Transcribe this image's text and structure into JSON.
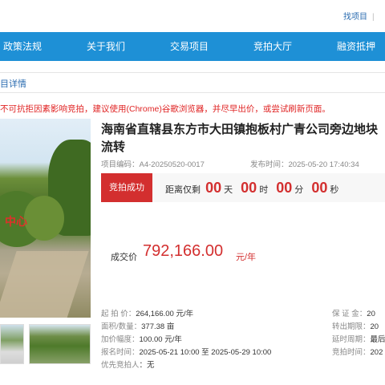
{
  "header": {
    "link_items": "找项目",
    "link_separator": "|"
  },
  "nav": {
    "items": [
      "政策法规",
      "关于我们",
      "交易项目",
      "竞拍大厅",
      "融资抵押"
    ]
  },
  "breadcrumb": "目详情",
  "notice": "不可抗拒因素影响竞拍，建议使用(Chrome)谷歌浏览器，并尽早出价，或尝试刷新页面。",
  "gallery": {
    "photo_label": "中心"
  },
  "project": {
    "title": "海南省直辖县东方市大田镇抱板村广青公司旁边地块流转",
    "code_label": "项目编码：",
    "code": "A4-20250520-0017",
    "publish_label": "发布时间：",
    "publish_time": "2025-05-20 17:40:34"
  },
  "status": {
    "badge": "竞拍成功",
    "countdown_label": "距离仅剩",
    "days": "00",
    "days_unit": "天",
    "hours": "00",
    "hours_unit": "时",
    "minutes": "00",
    "minutes_unit": "分",
    "seconds": "00",
    "seconds_unit": "秒"
  },
  "deal": {
    "label": "成交价",
    "value": "792,166.00",
    "unit": "元/年"
  },
  "specs": {
    "start_price_label": "起 拍 价：",
    "start_price": "264,166.00 元/年",
    "area_label": "面积/数量：",
    "area": "377.38 亩",
    "increment_label": "加价幅度：",
    "increment": "100.00 元/年",
    "signup_label": "报名时间：",
    "signup": "2025-05-21 10:00 至 2025-05-29 10:00",
    "priority_label": "优先竞拍人",
    "priority": "：无",
    "deposit_label": "保 证 金：",
    "deposit": "20",
    "term_label": "转出期限：",
    "term": "20",
    "extend_label": "延时周期：",
    "extend": "最后",
    "auction_label": "竞拍时间：",
    "auction": "202"
  }
}
